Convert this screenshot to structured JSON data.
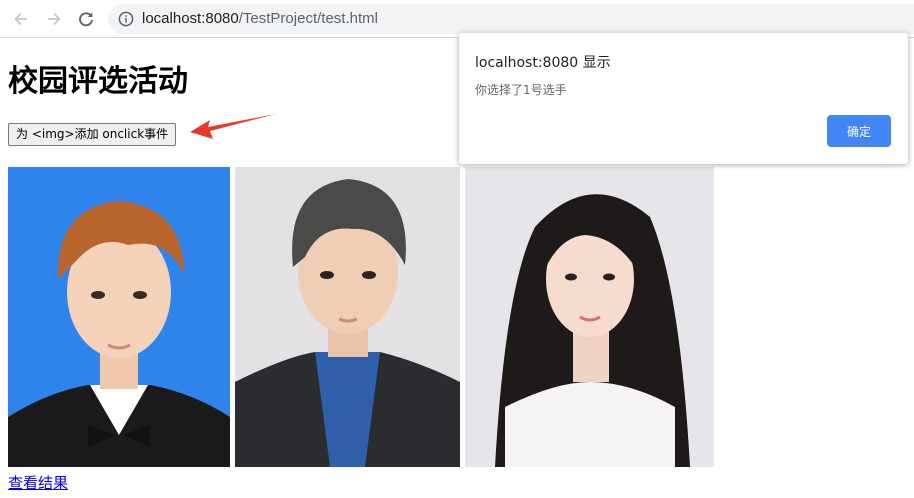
{
  "browser": {
    "url_host": "localhost:8080",
    "url_path": "/TestProject/test.html",
    "back_icon": "arrow-left-icon",
    "forward_icon": "arrow-right-icon",
    "reload_icon": "reload-icon",
    "info_icon": "info-icon"
  },
  "page": {
    "title": "校园评选活动",
    "button_label": "为 <img>添加 onclick事件",
    "result_link": "查看结果",
    "photos": [
      {
        "name": "candidate-1",
        "bg": "#2f84ec"
      },
      {
        "name": "candidate-2",
        "bg": "#e3e1e3"
      },
      {
        "name": "candidate-3",
        "bg": "#e6e6ea"
      }
    ],
    "annotation_color": "#e8392f"
  },
  "dialog": {
    "title": "localhost:8080 显示",
    "message": "你选择了1号选手",
    "ok_label": "确定",
    "ok_color": "#4285f4"
  }
}
